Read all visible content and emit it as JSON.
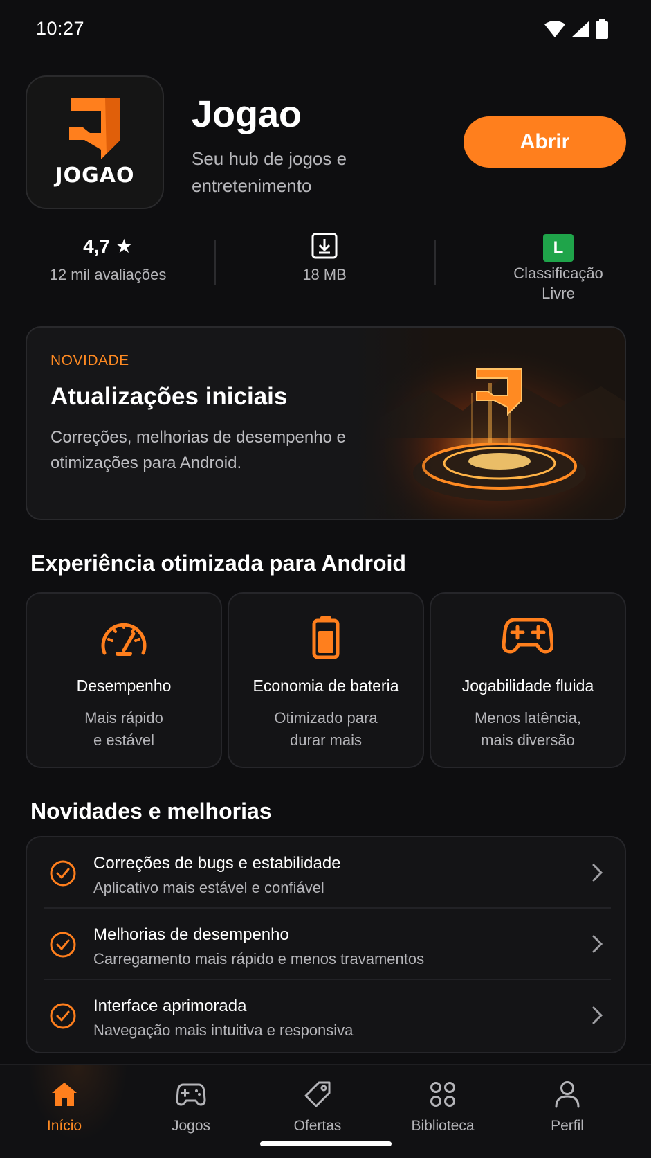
{
  "status_bar": {
    "time": "10:27",
    "icons": [
      "wifi-icon",
      "signal-icon",
      "battery-icon"
    ]
  },
  "app": {
    "logo_text": "JOGAO",
    "title": "Jogao",
    "subtitle": "Seu hub de jogos e entretenimento",
    "open_label": "Abrir",
    "accent_color": "#ff7f1d"
  },
  "stats": {
    "rating_value": "4,7 ★",
    "rating_label": "12 mil avaliações",
    "size_label": "18 MB",
    "age_badge": "L",
    "age_label_1": "Classificação",
    "age_label_2": "Livre"
  },
  "news": {
    "tag": "NOVIDADE",
    "title": "Atualizações iniciais",
    "text": "Correções, melhorias de desempenho e otimizações para Android."
  },
  "features": {
    "section_title": "Experiência otimizada para Android",
    "items": [
      {
        "icon": "speedometer-icon",
        "title": "Desempenho",
        "desc_1": "Mais rápido",
        "desc_2": "e estável"
      },
      {
        "icon": "battery-icon",
        "title": "Economia de bateria",
        "desc_1": "Otimizado para",
        "desc_2": "durar mais"
      },
      {
        "icon": "gamepad-icon",
        "title": "Jogabilidade fluida",
        "desc_1": "Menos latência,",
        "desc_2": "mais diversão"
      }
    ]
  },
  "improvements": {
    "section_title": "Novidades e melhorias",
    "items": [
      {
        "title": "Correções de bugs e estabilidade",
        "subtitle": "Aplicativo mais estável e confiável"
      },
      {
        "title": "Melhorias de desempenho",
        "subtitle": "Carregamento mais rápido e menos travamentos"
      },
      {
        "title": "Interface aprimorada",
        "subtitle": "Navegação mais intuitiva e responsiva"
      }
    ]
  },
  "nav": {
    "items": [
      {
        "icon": "home-icon",
        "label": "Início",
        "active": true
      },
      {
        "icon": "gamepad-icon",
        "label": "Jogos"
      },
      {
        "icon": "tag-icon",
        "label": "Ofertas"
      },
      {
        "icon": "grid-icon",
        "label": "Biblioteca"
      },
      {
        "icon": "profile-icon",
        "label": "Perfil"
      }
    ]
  }
}
